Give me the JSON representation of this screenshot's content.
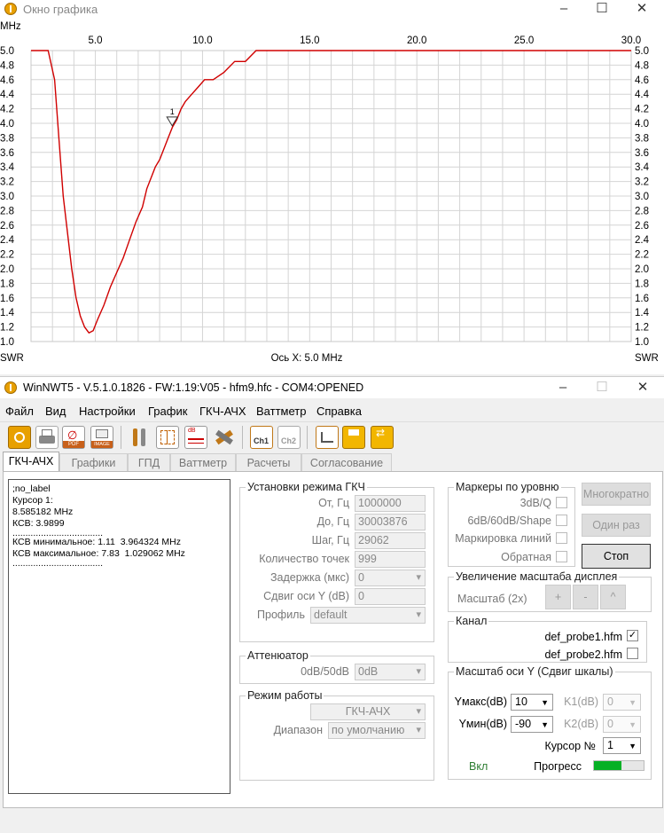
{
  "graph_window": {
    "title": "Окно графика",
    "chart_data": {
      "type": "line",
      "xlabel": "Ось X: 5.0 MHz",
      "x_unit": "MHz",
      "y_unit": "SWR",
      "xlim": [
        2.0,
        30.0
      ],
      "ylim": [
        1.0,
        5.0
      ],
      "x_ticks": [
        "5.0",
        "10.0",
        "15.0",
        "20.0",
        "25.0",
        "30.0"
      ],
      "y_ticks": [
        "5.0",
        "4.8",
        "4.6",
        "4.4",
        "4.2",
        "4.0",
        "3.8",
        "3.6",
        "3.4",
        "3.2",
        "3.0",
        "2.8",
        "2.6",
        "2.4",
        "2.2",
        "2.0",
        "1.8",
        "1.6",
        "1.4",
        "1.2",
        "1.0"
      ],
      "grid": true,
      "series": [
        {
          "color": "#d00000",
          "x": [
            2.0,
            2.8,
            3.1,
            3.3,
            3.5,
            3.7,
            3.9,
            4.1,
            4.3,
            4.5,
            4.7,
            4.9,
            5.1,
            5.4,
            5.7,
            6.0,
            6.3,
            6.6,
            6.9,
            7.2,
            7.4,
            7.6,
            7.8,
            8.0,
            8.2,
            8.4,
            8.6,
            8.8,
            9.0,
            9.2,
            9.5,
            9.8,
            10.1,
            10.5,
            11.0,
            11.5,
            12.0,
            12.5,
            13.0,
            14.0,
            16.0,
            20.0,
            25.0,
            30.0
          ],
          "y": [
            5.0,
            5.0,
            4.6,
            3.8,
            3.0,
            2.5,
            2.0,
            1.6,
            1.35,
            1.2,
            1.12,
            1.15,
            1.3,
            1.5,
            1.75,
            1.95,
            2.15,
            2.4,
            2.65,
            2.85,
            3.1,
            3.25,
            3.4,
            3.5,
            3.65,
            3.8,
            3.95,
            4.05,
            4.2,
            4.3,
            4.4,
            4.5,
            4.6,
            4.6,
            4.7,
            4.85,
            4.85,
            5.0,
            5.0,
            5.0,
            5.0,
            5.0,
            5.0,
            5.0
          ]
        }
      ],
      "marker": {
        "label": "1",
        "x": 8.585182,
        "y": 3.9899
      }
    }
  },
  "main_window": {
    "title": "WinNWT5 - V.5.1.0.1826 - FW:1.19:V05 - hfm9.hfc - COM4:OPENED",
    "menu": [
      "Файл",
      "Вид",
      "Настройки",
      "График",
      "ГКЧ-АЧХ",
      "Ваттметр",
      "Справка"
    ],
    "toolbar_icons": [
      "power-icon",
      "print-icon",
      "pdf-icon",
      "image-icon",
      "settings-tools-icon",
      "grid-icon",
      "db-icon",
      "calibrate-icon",
      "ch1-icon",
      "ch2-icon",
      "sweep-icon",
      "save-icon",
      "swap-icon"
    ],
    "toolbar_labels": {
      "pdf": "PDF",
      "image": "IMAGE",
      "db": "dB",
      "ch1": "Ch1",
      "ch2": "Ch2"
    },
    "tabs": [
      "ГКЧ-АЧХ",
      "Графики",
      "ГПД",
      "Ваттметр",
      "Расчеты",
      "Согласование"
    ],
    "log": {
      "lines": [
        ";no_label",
        "",
        "Курсор 1:",
        "8.585182 MHz",
        "КСВ: 3.9899",
        "...................................",
        "",
        "КСВ минимальное: 1.11  3.964324 MHz",
        "КСВ максимальное: 7.83  1.029062 MHz",
        "..................................."
      ]
    },
    "sweep_settings": {
      "title": "Установки режима ГКЧ",
      "from_label": "От, Гц",
      "from_value": "1000000",
      "to_label": "До, Гц",
      "to_value": "30003876",
      "step_label": "Шаг, Гц",
      "step_value": "29062",
      "points_label": "Количество точек",
      "points_value": "999",
      "delay_label": "Задержка (мкс)",
      "delay_value": "0",
      "yshift_label": "Сдвиг оси Y (dB)",
      "yshift_value": "0",
      "profile_label": "Профиль",
      "profile_value": "default"
    },
    "attenuator": {
      "title": "Аттенюатор",
      "label": "0dB/50dB",
      "value": "0dB"
    },
    "mode": {
      "title": "Режим работы",
      "mode_value": "ГКЧ-АЧХ",
      "range_label": "Диапазон",
      "range_value": "по умолчанию"
    },
    "markers": {
      "title": "Маркеры по уровню",
      "items": [
        "3dB/Q",
        "6dB/60dB/Shape",
        "Маркировка линий",
        "Обратная"
      ]
    },
    "buttons": {
      "multi": "Многократно",
      "once": "Один раз",
      "stop": "Стоп"
    },
    "zoom": {
      "title": "Увеличение масштаба дисплея",
      "label": "Масштаб (2x)",
      "plus": "+",
      "minus": "-",
      "up": "^"
    },
    "channel": {
      "title": "Канал",
      "probe1": "def_probe1.hfm",
      "probe1_checked": true,
      "probe2": "def_probe2.hfm",
      "probe2_checked": false
    },
    "yaxis": {
      "title": "Масштаб оси Y (Сдвиг шкалы)",
      "ymax_label": "Yмакс(dB)",
      "ymax_value": "10",
      "ymin_label": "Yмин(dB)",
      "ymin_value": "-90",
      "k1_label": "K1(dB)",
      "k1_value": "0",
      "k2_label": "K2(dB)",
      "k2_value": "0",
      "cursor_label": "Курсор №",
      "cursor_value": "1",
      "on_label": "Вкл",
      "progress_label": "Прогресс",
      "progress": 0.55
    },
    "colors": {
      "on_text": "#2e7d32",
      "progress": "#06b025",
      "curve": "#d00000"
    }
  }
}
